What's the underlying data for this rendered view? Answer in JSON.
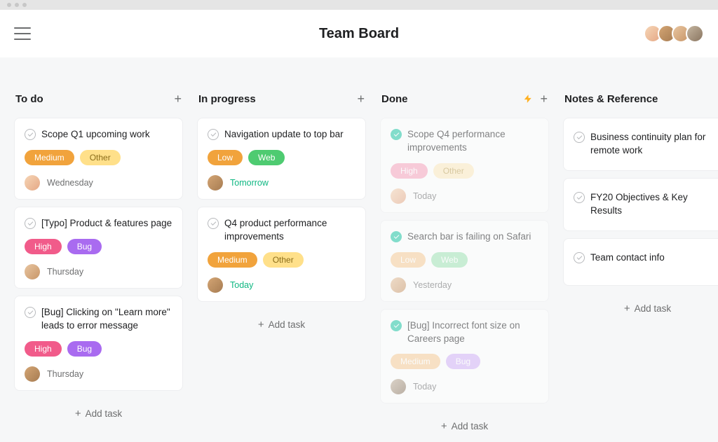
{
  "header": {
    "title": "Team Board"
  },
  "addTaskLabel": "Add task",
  "columns": [
    {
      "title": "To do",
      "hasRule": false,
      "cards": [
        {
          "title": "Scope Q1 upcoming work",
          "completed": false,
          "tags": [
            {
              "label": "Medium",
              "bg": "#f1a33c"
            },
            {
              "label": "Other",
              "bg": "#ffe08a",
              "fg": "#8a6d1a"
            }
          ],
          "assignee": "av1",
          "due": "Wednesday",
          "dueSoon": false
        },
        {
          "title": "[Typo] Product & features page",
          "completed": false,
          "tags": [
            {
              "label": "High",
              "bg": "#f15b8a"
            },
            {
              "label": "Bug",
              "bg": "#a96bf0"
            }
          ],
          "assignee": "av3",
          "due": "Thursday",
          "dueSoon": false
        },
        {
          "title": "[Bug] Clicking on \"Learn more\" leads to error message",
          "completed": false,
          "tags": [
            {
              "label": "High",
              "bg": "#f15b8a"
            },
            {
              "label": "Bug",
              "bg": "#a96bf0"
            }
          ],
          "assignee": "av2",
          "due": "Thursday",
          "dueSoon": false
        }
      ]
    },
    {
      "title": "In progress",
      "hasRule": false,
      "cards": [
        {
          "title": "Navigation update to top bar",
          "completed": false,
          "tags": [
            {
              "label": "Low",
              "bg": "#f1a33c"
            },
            {
              "label": "Web",
              "bg": "#4ecb71"
            }
          ],
          "assignee": "av2",
          "due": "Tomorrow",
          "dueSoon": true
        },
        {
          "title": "Q4 product performance improvements",
          "completed": false,
          "tags": [
            {
              "label": "Medium",
              "bg": "#f1a33c"
            },
            {
              "label": "Other",
              "bg": "#ffe08a",
              "fg": "#8a6d1a"
            }
          ],
          "assignee": "av2",
          "due": "Today",
          "dueSoon": true
        }
      ]
    },
    {
      "title": "Done",
      "hasRule": true,
      "cards": [
        {
          "title": "Scope Q4 performance improvements",
          "completed": true,
          "tags": [
            {
              "label": "High",
              "bg": "#f9a6bf"
            },
            {
              "label": "Other",
              "bg": "#ffecc0",
              "fg": "#bfa35a"
            }
          ],
          "assignee": "av1",
          "due": "Today",
          "dueSoon": false
        },
        {
          "title": "Search bar is failing on Safari",
          "completed": true,
          "tags": [
            {
              "label": "Low",
              "bg": "#f9cf9a"
            },
            {
              "label": "Web",
              "bg": "#a3e6b8"
            }
          ],
          "assignee": "av3",
          "due": "Yesterday",
          "dueSoon": false
        },
        {
          "title": "[Bug] Incorrect font size on Careers page",
          "completed": true,
          "tags": [
            {
              "label": "Medium",
              "bg": "#f9cf9a"
            },
            {
              "label": "Bug",
              "bg": "#d4b5f8"
            }
          ],
          "assignee": "av4",
          "due": "Today",
          "dueSoon": false
        }
      ]
    },
    {
      "title": "Notes & Reference",
      "hasRule": false,
      "simple": true,
      "cards": [
        {
          "title": "Business continuity plan for remote work",
          "completed": false
        },
        {
          "title": "FY20 Objectives & Key Results",
          "completed": false
        },
        {
          "title": "Team contact info",
          "completed": false
        }
      ]
    }
  ]
}
